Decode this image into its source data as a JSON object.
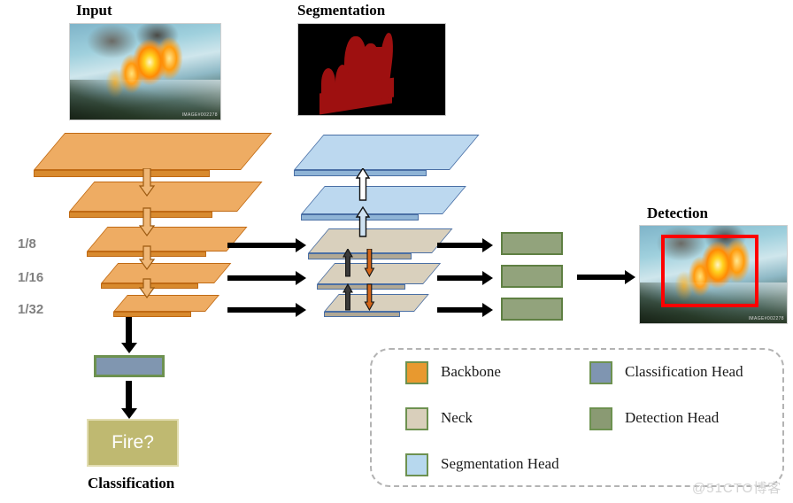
{
  "titles": {
    "input": "Input",
    "segmentation": "Segmentation",
    "detection": "Detection",
    "classification": "Classification"
  },
  "scale_labels": [
    "1/8",
    "1/16",
    "1/32"
  ],
  "classification": {
    "output_label": "Fire?"
  },
  "image_watermarks": {
    "input": "IMAGE#002278",
    "detection": "IMAGE#002278"
  },
  "legend": {
    "items": [
      {
        "label": "Backbone",
        "color": "#e8992f"
      },
      {
        "label": "Neck",
        "color": "#d9cfbb"
      },
      {
        "label": "Segmentation Head",
        "color": "#b7d8ee"
      },
      {
        "label": "Classification Head",
        "color": "#7f95b1"
      },
      {
        "label": "Detection Head",
        "color": "#8a9a73"
      }
    ],
    "border_color": "#b3b3b3"
  },
  "colors": {
    "backbone_fill": "#eda champion",
    "backbone_top": "#eeac63",
    "backbone_side": "#c97b22",
    "backbone_edge": "#c06a14",
    "neck_top": "#d9d0bd",
    "neck_side": "#b9b09c",
    "neck_edge": "#4a6fa5",
    "seghead_top": "#bcd8ef",
    "seghead_side": "#8fb4d6",
    "seghead_edge": "#4a6fa5",
    "clshead_fill": "#8096b0",
    "clshead_border": "#6d9150",
    "dethead_fill": "#92a37c",
    "dethead_border": "#5f8043",
    "fire_box_fill": "#bfb971",
    "fire_box_border": "#e2ddb2",
    "detection_bbox": "#ff0000",
    "mask_red": "#9e1010",
    "scale_text": "#808080",
    "arrow_up_neck": "#3b3b3b",
    "arrow_down_neck": "#d4661a"
  },
  "watermark": "@51CTO博客",
  "structure": {
    "backbone_layers": 5,
    "neck_layers": 3,
    "segmentation_head_layers": 2,
    "detection_head_boxes": 3,
    "classification_head_boxes": 1
  }
}
